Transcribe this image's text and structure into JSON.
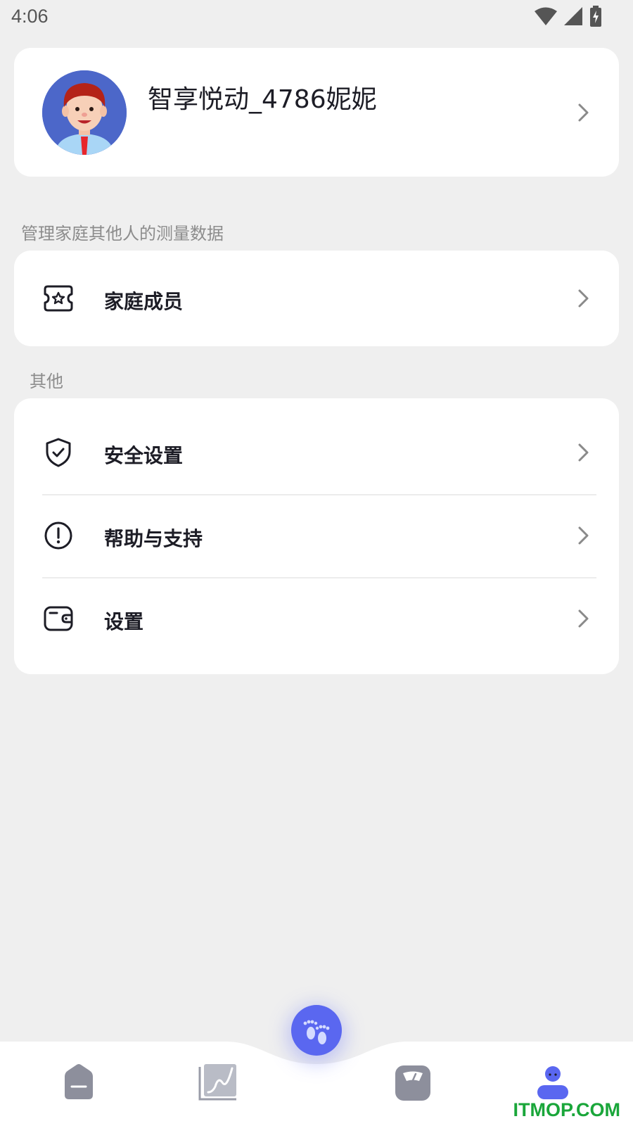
{
  "status_bar": {
    "time": "4:06",
    "icons": [
      "wifi-icon",
      "signal-icon",
      "battery-charging-icon"
    ]
  },
  "profile": {
    "name": "智享悦动_4786妮妮",
    "avatar": "avatar-image"
  },
  "family_section": {
    "caption": "管理家庭其他人的测量数据",
    "item": {
      "label": "家庭成员",
      "icon": "family-ticket-icon"
    }
  },
  "other_section": {
    "caption": "其他",
    "items": [
      {
        "label": "安全设置",
        "icon": "shield-check-icon"
      },
      {
        "label": "帮助与支持",
        "icon": "info-circle-icon"
      },
      {
        "label": "设置",
        "icon": "wallet-icon"
      }
    ]
  },
  "tab_bar": {
    "tabs": [
      "home-icon",
      "chart-icon",
      "scale-icon",
      "profile-icon"
    ],
    "center_button": "footprints-icon",
    "active_tab": "profile-icon",
    "active_color": "#5a67f0",
    "inactive_color": "#8d8f9c"
  },
  "watermark": "ITMOP.COM"
}
